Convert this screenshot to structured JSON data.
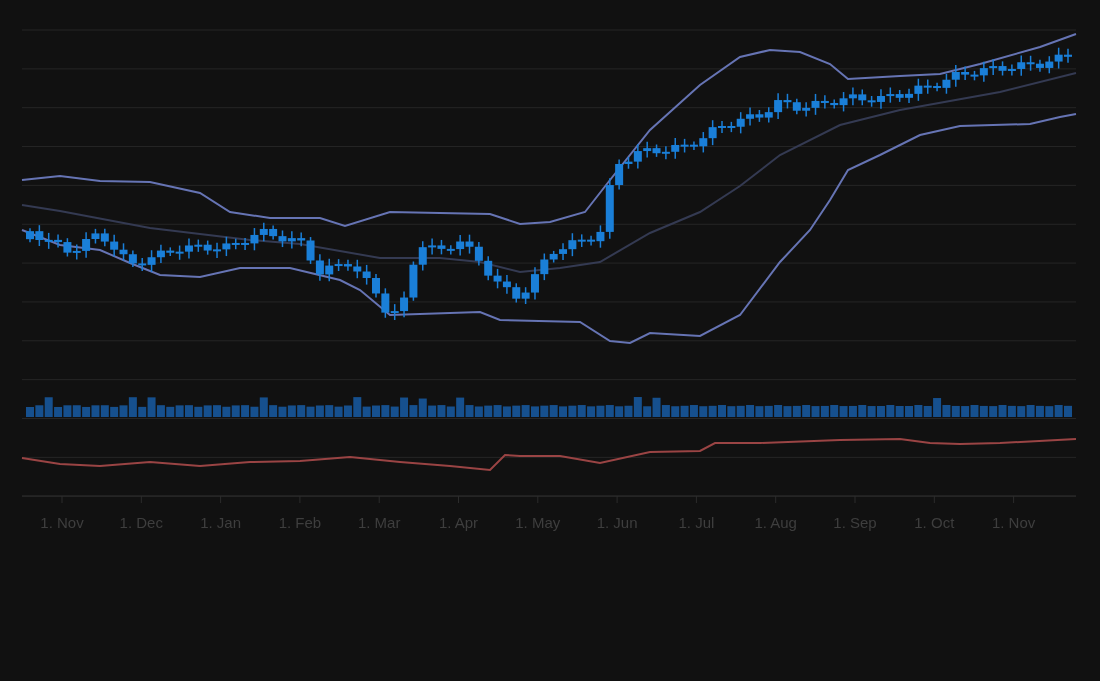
{
  "chart": {
    "x_axis_labels": [
      "1. Nov",
      "1. Dec",
      "1. Jan",
      "1. Feb",
      "1. Mar",
      "1. Apr",
      "1. May",
      "1. Jun",
      "1. Jul",
      "1. Aug",
      "1. Sep",
      "1. Oct",
      "1. Nov"
    ]
  }
}
